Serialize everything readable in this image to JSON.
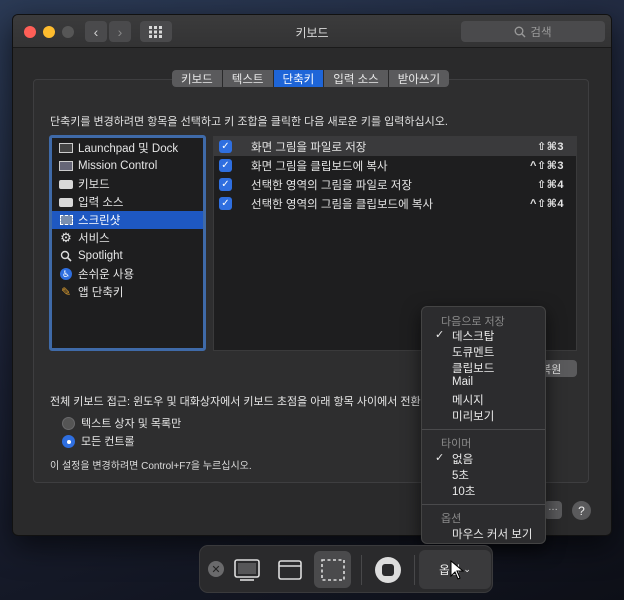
{
  "window": {
    "title": "키보드",
    "search_placeholder": "검색",
    "traffic_lights": {
      "close": "#ff5f57",
      "minimize": "#febc2e",
      "zoom": "#565656"
    }
  },
  "tabs": [
    {
      "label": "키보드",
      "active": false
    },
    {
      "label": "텍스트",
      "active": false
    },
    {
      "label": "단축키",
      "active": true
    },
    {
      "label": "입력 소스",
      "active": false
    },
    {
      "label": "받아쓰기",
      "active": false
    }
  ],
  "instruction": "단축키를 변경하려면 항목을 선택하고 키 조합을 클릭한 다음 새로운 키를 입력하십시오.",
  "categories": [
    {
      "label": "Launchpad 및 Dock",
      "icon": "launchpad-icon"
    },
    {
      "label": "Mission Control",
      "icon": "mission-control-icon"
    },
    {
      "label": "키보드",
      "icon": "keyboard-icon"
    },
    {
      "label": "입력 소스",
      "icon": "keyboard-icon"
    },
    {
      "label": "스크린샷",
      "icon": "screenshot-icon",
      "selected": true
    },
    {
      "label": "서비스",
      "icon": "gear-icon"
    },
    {
      "label": "Spotlight",
      "icon": "spotlight-icon"
    },
    {
      "label": "손쉬운 사용",
      "icon": "accessibility-icon"
    },
    {
      "label": "앱 단축키",
      "icon": "app-shortcuts-icon"
    }
  ],
  "shortcuts": [
    {
      "label": "화면 그림을 파일로 저장",
      "keys": "⇧⌘3",
      "checked": true
    },
    {
      "label": "화면 그림을 클립보드에 복사",
      "keys": "^⇧⌘3",
      "checked": true
    },
    {
      "label": "선택한 영역의 그림을 파일로 저장",
      "keys": "⇧⌘4",
      "checked": true
    },
    {
      "label": "선택한 영역의 그림을 클립보드에 복사",
      "keys": "^⇧⌘4",
      "checked": true
    }
  ],
  "restore_button": "복원",
  "full_keyboard_access": {
    "title": "전체 키보드 접근: 윈도우 및 대화상자에서 키보드 초점을 아래 항목 사이에서 전환",
    "options": [
      {
        "label": "텍스트 상자 및 목록만",
        "selected": false
      },
      {
        "label": "모든 컨트롤",
        "selected": true
      }
    ],
    "hint": "이 설정을 변경하려면 Control+F7을 누르십시오."
  },
  "help_button": "?",
  "options_menu": {
    "save_to_header": "다음으로 저장",
    "save_to_items": [
      {
        "label": "데스크탑",
        "checked": true
      },
      {
        "label": "도큐멘트"
      },
      {
        "label": "클립보드"
      },
      {
        "label": "Mail"
      },
      {
        "label": "메시지"
      },
      {
        "label": "미리보기"
      }
    ],
    "timer_header": "타이머",
    "timer_items": [
      {
        "label": "없음",
        "checked": true
      },
      {
        "label": "5초"
      },
      {
        "label": "10초"
      }
    ],
    "options_header": "옵션",
    "options_items": [
      {
        "label": "마우스 커서 보기"
      }
    ]
  },
  "screenshot_toolbar": {
    "options_label": "옵션",
    "accent": "#1e65d8"
  }
}
